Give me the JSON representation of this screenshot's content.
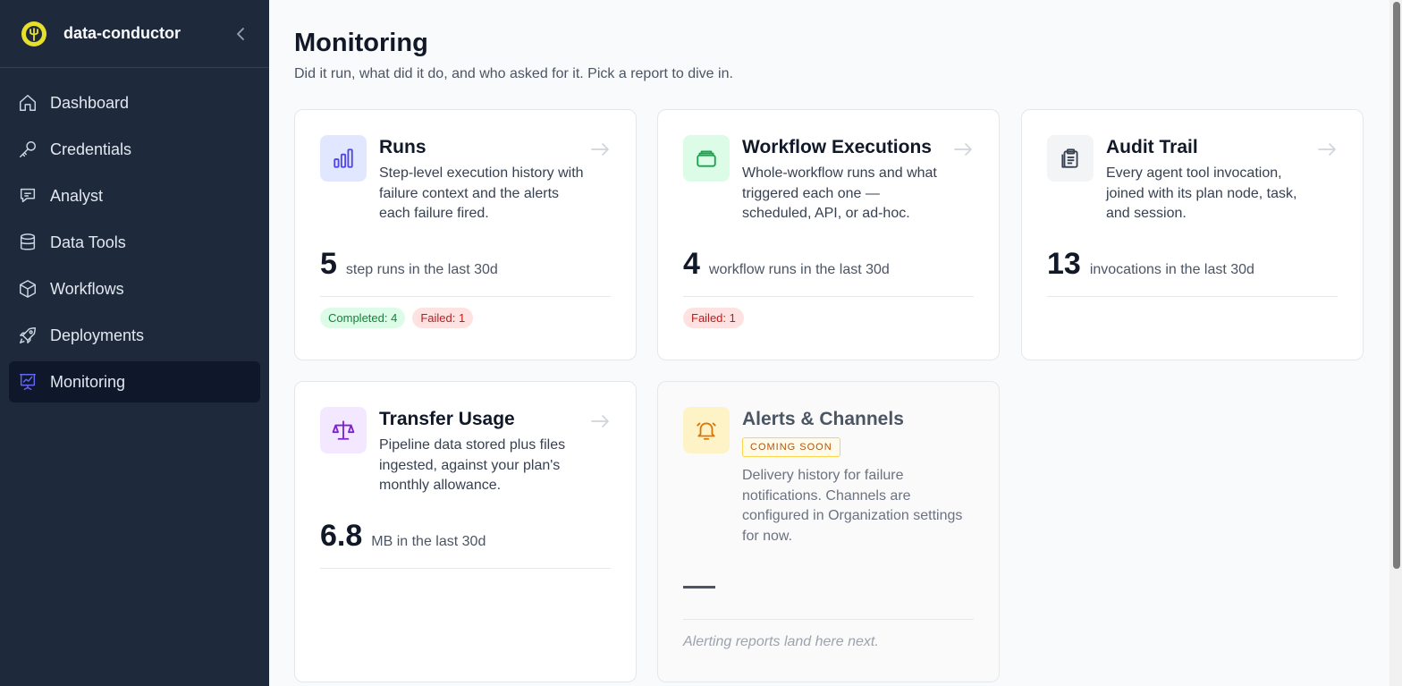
{
  "app": {
    "name": "data-conductor"
  },
  "sidebar": {
    "items": [
      {
        "label": "Dashboard",
        "icon": "home-icon"
      },
      {
        "label": "Credentials",
        "icon": "key-icon"
      },
      {
        "label": "Analyst",
        "icon": "chat-icon"
      },
      {
        "label": "Data Tools",
        "icon": "database-icon"
      },
      {
        "label": "Workflows",
        "icon": "box-icon"
      },
      {
        "label": "Deployments",
        "icon": "rocket-icon"
      },
      {
        "label": "Monitoring",
        "icon": "presentation-chart-icon",
        "active": true
      }
    ]
  },
  "page": {
    "title": "Monitoring",
    "subtitle": "Did it run, what did it do, and who asked for it. Pick a report to dive in."
  },
  "cards": {
    "runs": {
      "title": "Runs",
      "description": "Step-level execution history with failure context and the alerts each failure fired.",
      "metric_value": "5",
      "metric_label": "step runs in the last 30d",
      "badges": [
        "Completed: 4",
        "Failed: 1"
      ]
    },
    "workflow_executions": {
      "title": "Workflow Executions",
      "description": "Whole-workflow runs and what triggered each one — scheduled, API, or ad-hoc.",
      "metric_value": "4",
      "metric_label": "workflow runs in the last 30d",
      "badges": [
        "Failed: 1"
      ]
    },
    "audit_trail": {
      "title": "Audit Trail",
      "description": "Every agent tool invocation, joined with its plan node, task, and session.",
      "metric_value": "13",
      "metric_label": "invocations in the last 30d"
    },
    "transfer_usage": {
      "title": "Transfer Usage",
      "description": "Pipeline data stored plus files ingested, against your plan's monthly allowance.",
      "metric_value": "6.8",
      "metric_label": "MB in the last 30d"
    },
    "alerts": {
      "title": "Alerts & Channels",
      "badge": "COMING SOON",
      "description": "Delivery history for failure notifications. Channels are configured in Organization settings for now.",
      "footer": "Alerting reports land here next."
    }
  },
  "colors": {
    "sidebar_bg": "#1e293b",
    "accent": "#4f46e5",
    "runs_icon_bg": "#e0e7ff",
    "workflow_icon_bg": "#dcfce7",
    "audit_icon_bg": "#f3f4f6",
    "transfer_icon_bg": "#f3e8ff",
    "alerts_icon_bg": "#fef3c7"
  }
}
